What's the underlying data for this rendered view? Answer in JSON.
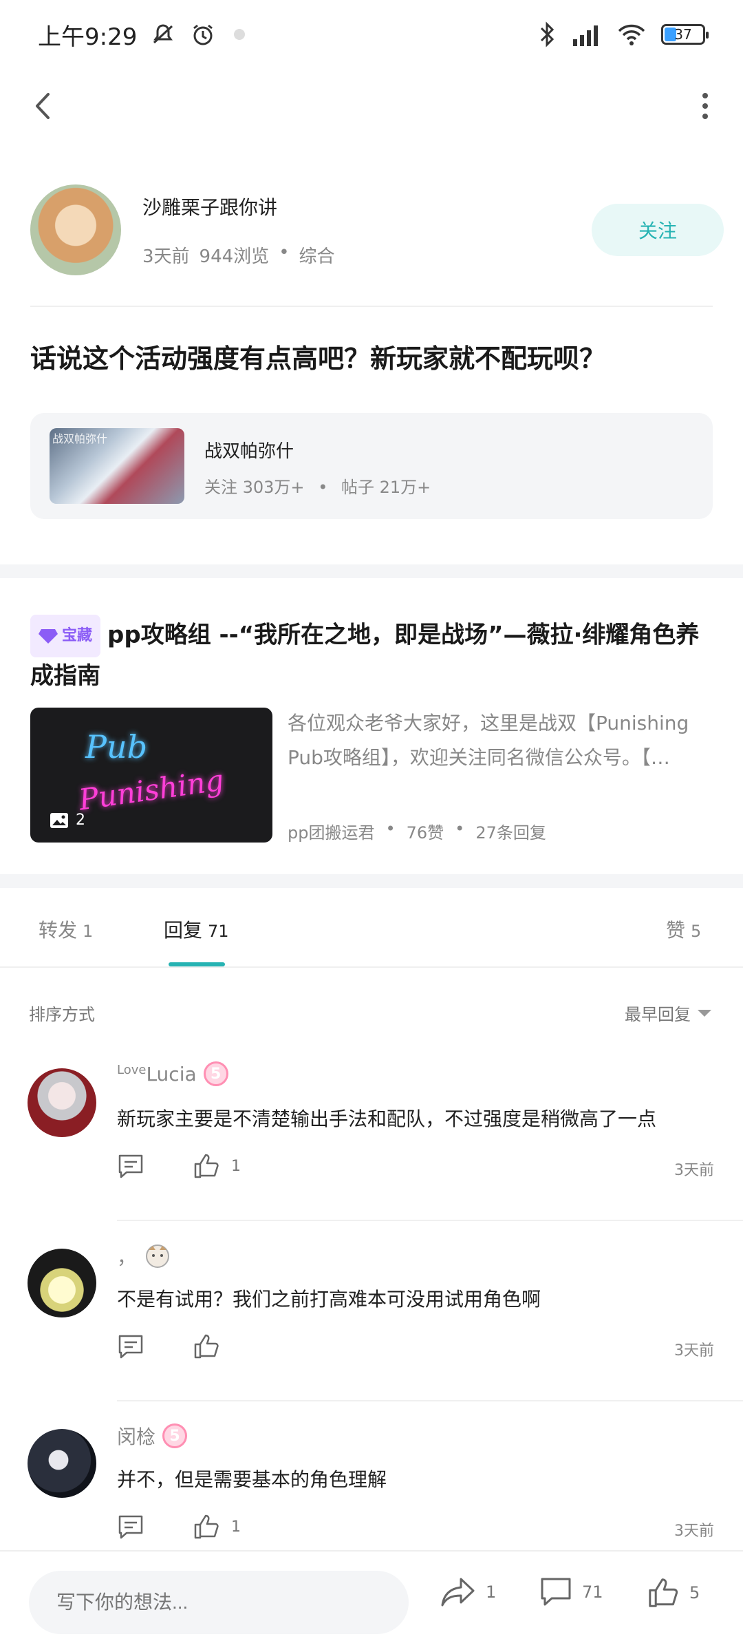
{
  "status_bar": {
    "time": "上午9:29",
    "battery": "37",
    "battery_level": 0.37
  },
  "author": {
    "name": "沙雕栗子跟你讲",
    "time_ago": "3天前",
    "views": "944浏览",
    "dot": "•",
    "category": "综合",
    "follow_label": "关注"
  },
  "post": {
    "title": "话说这个活动强度有点高吧？新玩家就不配玩呗？"
  },
  "game": {
    "thumb_watermark": "战双帕弥什",
    "name": "战双帕弥什",
    "followers": "关注 303万+",
    "dot": "•",
    "posts": "帖子 21万+"
  },
  "featured": {
    "badge": "宝藏",
    "title": "pp攻略组 --“我所在之地，即是战场”—薇拉·绯耀角色养成指南",
    "thumb_text_1": "Pub",
    "thumb_text_2": "Punishing",
    "image_count": "2",
    "description": "各位观众老爷大家好，这里是战双【Punishing Pub攻略组】，欢迎关注同名微信公众号。【…",
    "author": "pp团搬运君",
    "likes": "76赞",
    "replies": "27条回复",
    "dot": "•"
  },
  "tabs": [
    {
      "label": "转发",
      "count": "1"
    },
    {
      "label": "回复",
      "count": "71"
    },
    {
      "label": "赞",
      "count": "5"
    }
  ],
  "sort": {
    "label": "排序方式",
    "value": "最早回复"
  },
  "comments": [
    {
      "name_prefix": "Love",
      "name": "Lucia",
      "level": "5",
      "text": "新玩家主要是不清楚输出手法和配队，不过强度是稍微高了一点",
      "likes": "1",
      "time": "3天前"
    },
    {
      "name": "，",
      "text": "不是有试用？我们之前打高难本可没用试用角色啊",
      "likes": "",
      "time": "3天前"
    },
    {
      "name": "闵棯",
      "level": "5",
      "text": "并不，但是需要基本的角色理解",
      "likes": "1",
      "time": "3天前"
    }
  ],
  "bottom_bar": {
    "placeholder": "写下你的想法...",
    "shares": "1",
    "comments": "71",
    "likes": "5"
  },
  "colors": {
    "accent": "#26b3b3",
    "follow_bg": "#e8f8f7",
    "badge": "#8b5cf6",
    "level_badge": "#ff8fb3"
  }
}
